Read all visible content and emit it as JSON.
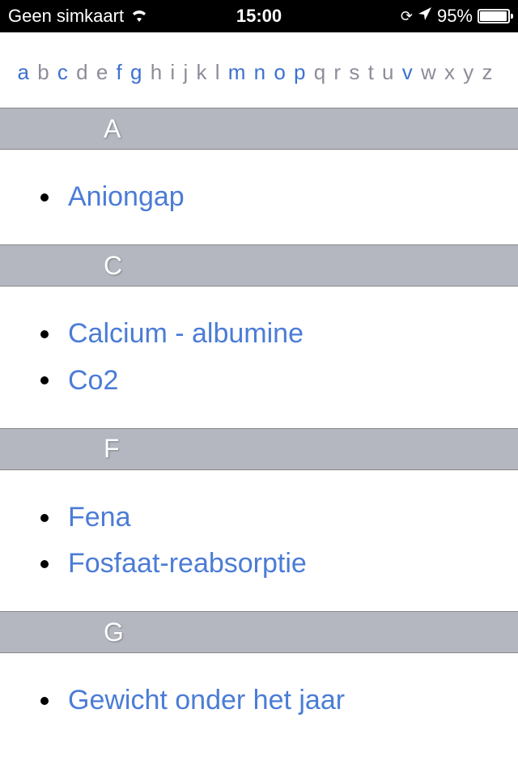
{
  "status": {
    "carrier": "Geen simkaart",
    "time": "15:00",
    "battery": "95%"
  },
  "alphabet": [
    {
      "l": "a",
      "active": true
    },
    {
      "l": "b",
      "active": false
    },
    {
      "l": "c",
      "active": true
    },
    {
      "l": "d",
      "active": false
    },
    {
      "l": "e",
      "active": false
    },
    {
      "l": "f",
      "active": true
    },
    {
      "l": "g",
      "active": true
    },
    {
      "l": "h",
      "active": false
    },
    {
      "l": "i",
      "active": false
    },
    {
      "l": "j",
      "active": false
    },
    {
      "l": "k",
      "active": false
    },
    {
      "l": "l",
      "active": false
    },
    {
      "l": "m",
      "active": true
    },
    {
      "l": "n",
      "active": true
    },
    {
      "l": "o",
      "active": true
    },
    {
      "l": "p",
      "active": true
    },
    {
      "l": "q",
      "active": false
    },
    {
      "l": "r",
      "active": false
    },
    {
      "l": "s",
      "active": false
    },
    {
      "l": "t",
      "active": false
    },
    {
      "l": "u",
      "active": false
    },
    {
      "l": "v",
      "active": true
    },
    {
      "l": "w",
      "active": false
    },
    {
      "l": "x",
      "active": false
    },
    {
      "l": "y",
      "active": false
    },
    {
      "l": "z",
      "active": false
    }
  ],
  "sections": [
    {
      "letter": "A",
      "items": [
        "Aniongap"
      ]
    },
    {
      "letter": "C",
      "items": [
        "Calcium - albumine",
        "Co2"
      ]
    },
    {
      "letter": "F",
      "items": [
        "Fena",
        "Fosfaat-reabsorptie"
      ]
    },
    {
      "letter": "G",
      "items": [
        "Gewicht onder het jaar"
      ]
    }
  ]
}
